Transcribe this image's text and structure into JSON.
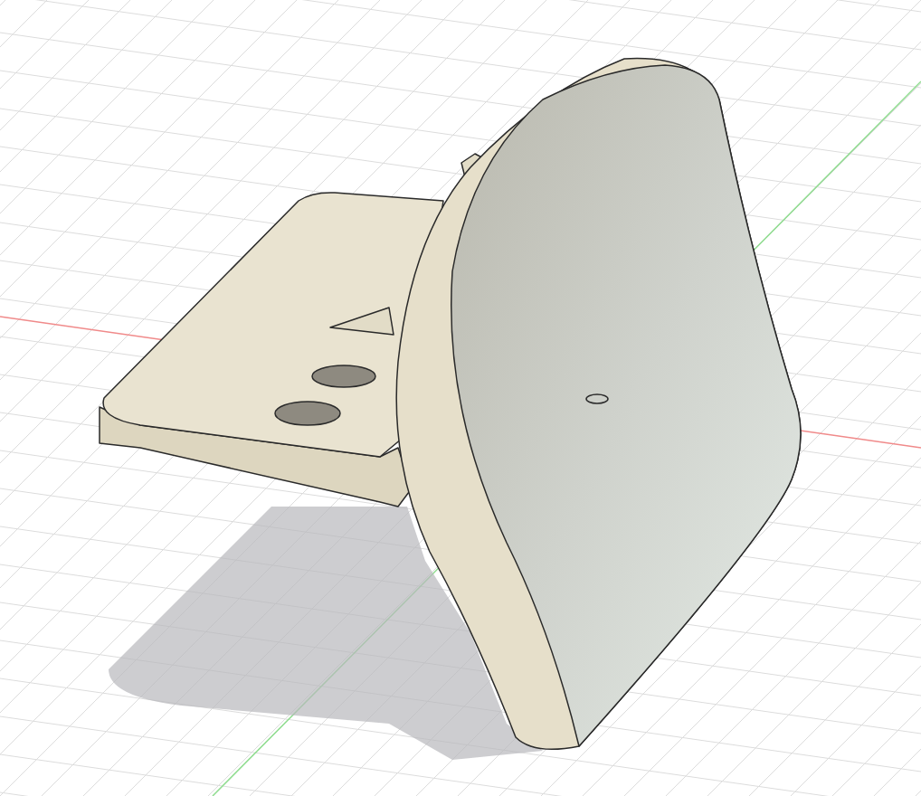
{
  "viewport": {
    "show_grid": true,
    "show_axes": true,
    "show_shadow": true
  }
}
